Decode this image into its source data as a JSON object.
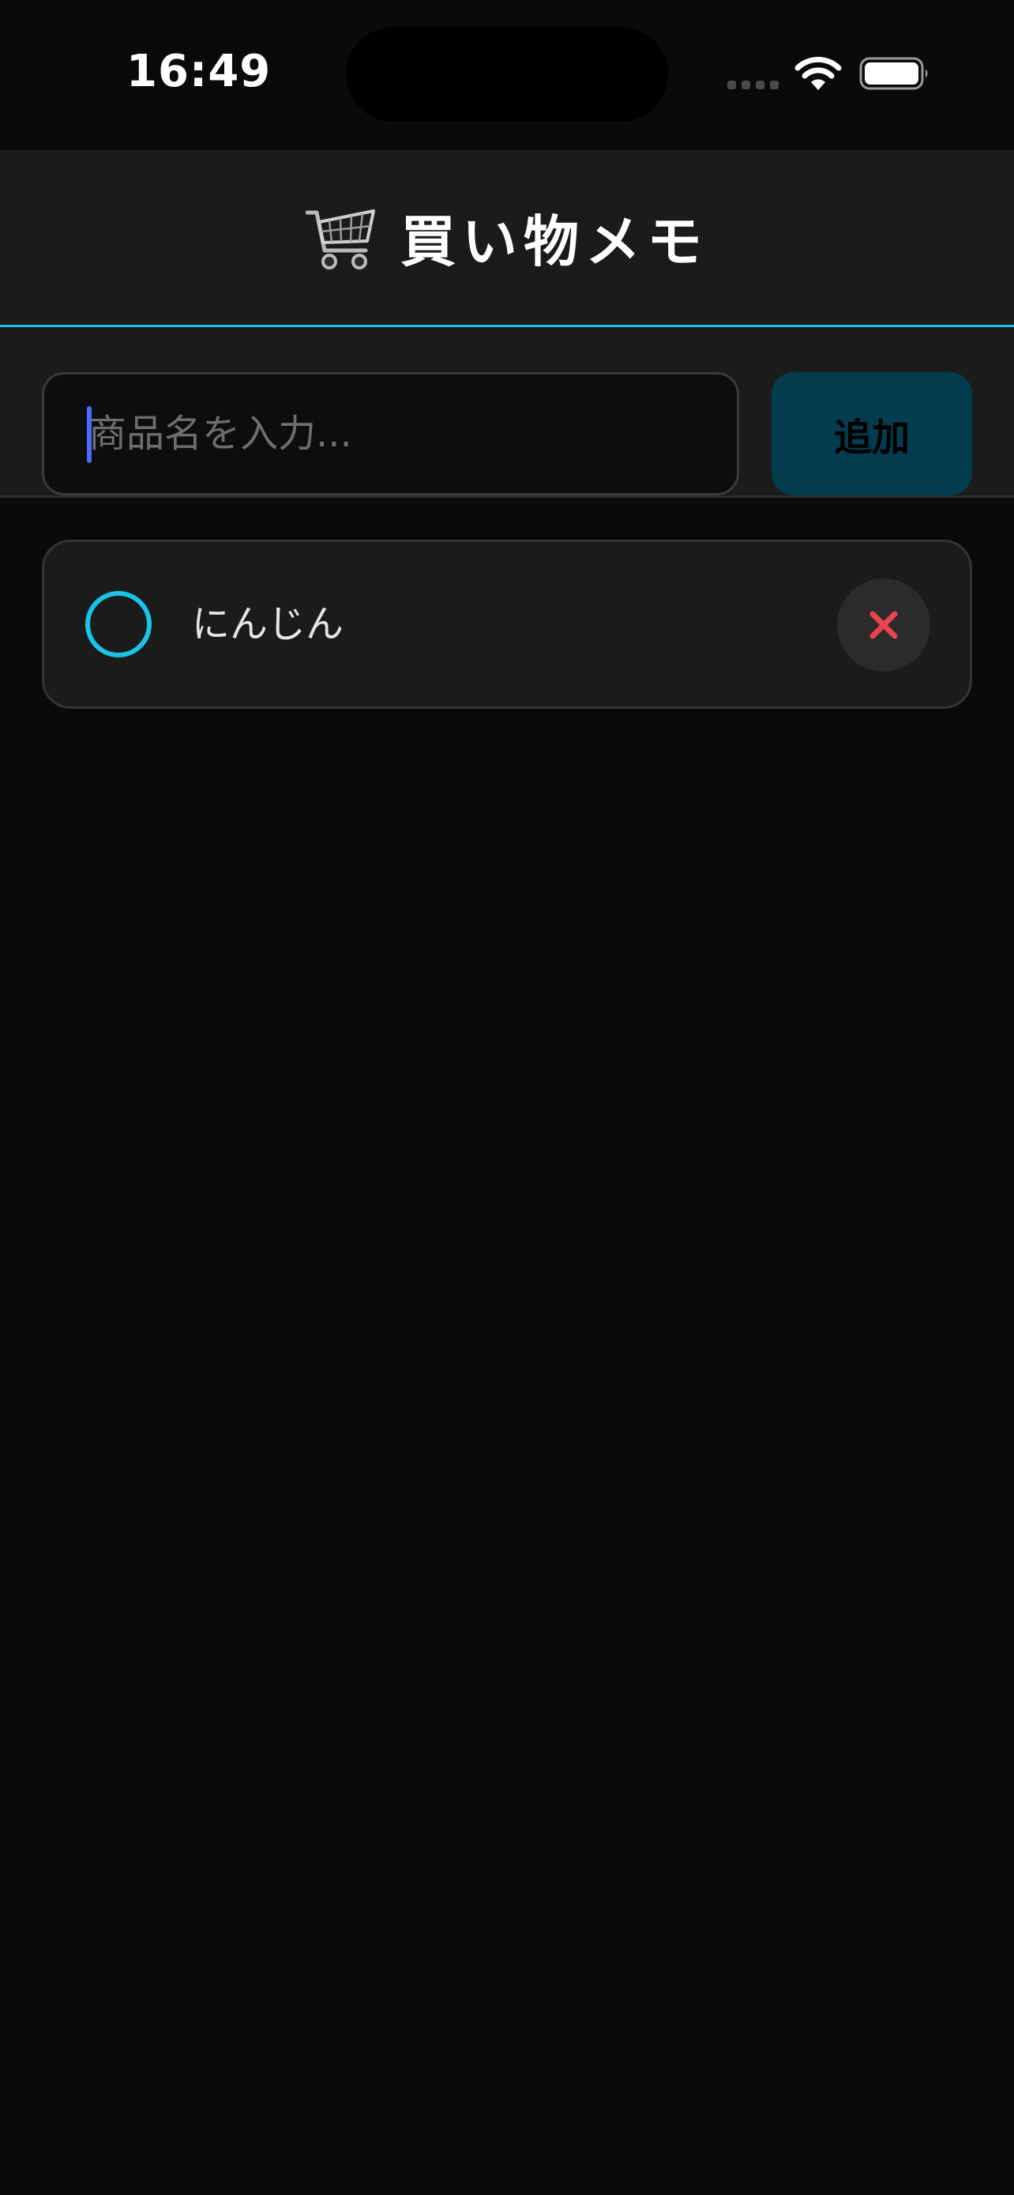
{
  "status_bar": {
    "time": "16:49",
    "icons": [
      "cellular-signal-icon",
      "wifi-icon",
      "battery-icon"
    ]
  },
  "header": {
    "icon": "shopping-cart-icon",
    "title": "買い物メモ"
  },
  "input": {
    "value": "",
    "placeholder": "商品名を入力..."
  },
  "add_button": {
    "label": "追加"
  },
  "items": [
    {
      "name": "にんじん",
      "checked": false
    }
  ],
  "colors": {
    "accent": "#19c4e8",
    "background": "#0a0a0a",
    "surface": "#1b1b1b",
    "add_button_bg": "#033c4e",
    "delete": "#e8434f",
    "caret": "#4a6bff"
  }
}
